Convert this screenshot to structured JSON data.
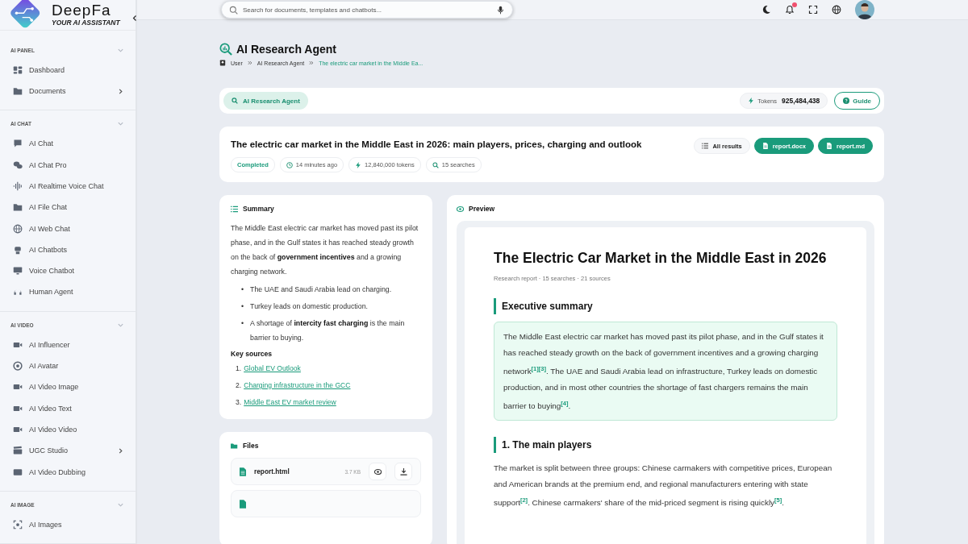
{
  "brand": {
    "name": "DeepFa",
    "tagline": "YOUR AI ASSISTANT"
  },
  "sidebar": {
    "sections": [
      {
        "title": "AI PANEL",
        "expanded": true,
        "items": [
          {
            "label": "Dashboard",
            "has_submenu": false
          },
          {
            "label": "Documents",
            "has_submenu": true
          }
        ]
      },
      {
        "title": "AI CHAT",
        "expanded": true,
        "items": [
          {
            "label": "AI Chat",
            "has_submenu": false
          },
          {
            "label": "AI Chat Pro",
            "has_submenu": false
          },
          {
            "label": "AI Realtime Voice Chat",
            "has_submenu": false
          },
          {
            "label": "AI File Chat",
            "has_submenu": false
          },
          {
            "label": "AI Web Chat",
            "has_submenu": false
          },
          {
            "label": "AI Chatbots",
            "has_submenu": false
          },
          {
            "label": "Voice Chatbot",
            "has_submenu": false
          },
          {
            "label": "Human Agent",
            "has_submenu": false
          }
        ]
      },
      {
        "title": "AI VIDEO",
        "expanded": true,
        "items": [
          {
            "label": "AI Influencer",
            "has_submenu": false
          },
          {
            "label": "AI Avatar",
            "has_submenu": false
          },
          {
            "label": "AI Video Image",
            "has_submenu": false
          },
          {
            "label": "AI Video Text",
            "has_submenu": false
          },
          {
            "label": "AI Video Video",
            "has_submenu": false
          },
          {
            "label": "UGC Studio",
            "has_submenu": true
          },
          {
            "label": "AI Video Dubbing",
            "has_submenu": false
          }
        ]
      },
      {
        "title": "AI IMAGE",
        "expanded": true,
        "items": [
          {
            "label": "AI Images",
            "has_submenu": false
          }
        ]
      }
    ]
  },
  "search": {
    "placeholder": "Search for documents, templates and chatbots..."
  },
  "notifications": {
    "unread": true
  },
  "page": {
    "title": "AI Research Agent",
    "breadcrumb": [
      "User",
      "AI Research Agent",
      "The electric car market in the Middle Ea..."
    ]
  },
  "toolbar": {
    "agent_chip": "AI Research Agent",
    "tokens_label": "Tokens",
    "tokens_value": "925,484,438",
    "guide": "Guide"
  },
  "report": {
    "title": "The electric car market in the Middle East in 2026: main players, prices, charging and outlook",
    "status": "Completed",
    "meta": [
      {
        "kind": "time",
        "text": "14 minutes ago"
      },
      {
        "kind": "tokens",
        "text": "12,840,000 tokens"
      },
      {
        "kind": "searches",
        "text": "15 searches"
      }
    ],
    "actions": [
      {
        "label": "All results",
        "primary": false
      },
      {
        "label": "report.docx",
        "primary": true
      },
      {
        "label": "report.md",
        "primary": true
      }
    ]
  },
  "summary": {
    "title": "Summary",
    "paragraph": "The Middle East electric car market has moved past its pilot phase, and in the Gulf states it has reached steady growth on the back of **government incentives** and a growing charging network.",
    "bullets": [
      {
        "marker": "•",
        "text": "The UAE and Saudi Arabia lead on charging."
      },
      {
        "marker": "•",
        "text": "Turkey leads on domestic production."
      },
      {
        "marker": "•",
        "text": "A shortage of **intercity fast charging** is the main barrier to buying."
      }
    ],
    "sources_title": "Key sources",
    "sources": [
      {
        "number": "1.",
        "title": "Global EV Outlook"
      },
      {
        "number": "2.",
        "title": "Charging infrastructure in the GCC"
      },
      {
        "number": "3.",
        "title": "Middle East EV market review"
      }
    ]
  },
  "files": {
    "title": "Files",
    "items": [
      {
        "name": "report.html",
        "size": "3.7 KB"
      }
    ]
  },
  "preview": {
    "title": "Preview",
    "doc_title": "The Electric Car Market in the Middle East in 2026",
    "doc_meta": "Research report · 15 searches · 21 sources",
    "sections": [
      {
        "kind": "callout",
        "heading": "Executive summary",
        "text": "The Middle East electric car market has moved past its pilot phase, and in the Gulf states it has reached steady growth on the back of government incentives and a growing charging network$^{[1][3]}$. The UAE and Saudi Arabia lead on infrastructure, Turkey leads on domestic production, and in most other countries the shortage of fast chargers remains the main barrier to buying$^{[4]}$."
      },
      {
        "kind": "paragraph",
        "heading": "1. The main players",
        "text": "The market is split between three groups: Chinese carmakers with competitive prices, European and American brands at the premium end, and regional manufacturers entering with state support$^{[2]}$. Chinese carmakers' share of the mid-priced segment is rising quickly$^{[5]}$."
      }
    ]
  }
}
